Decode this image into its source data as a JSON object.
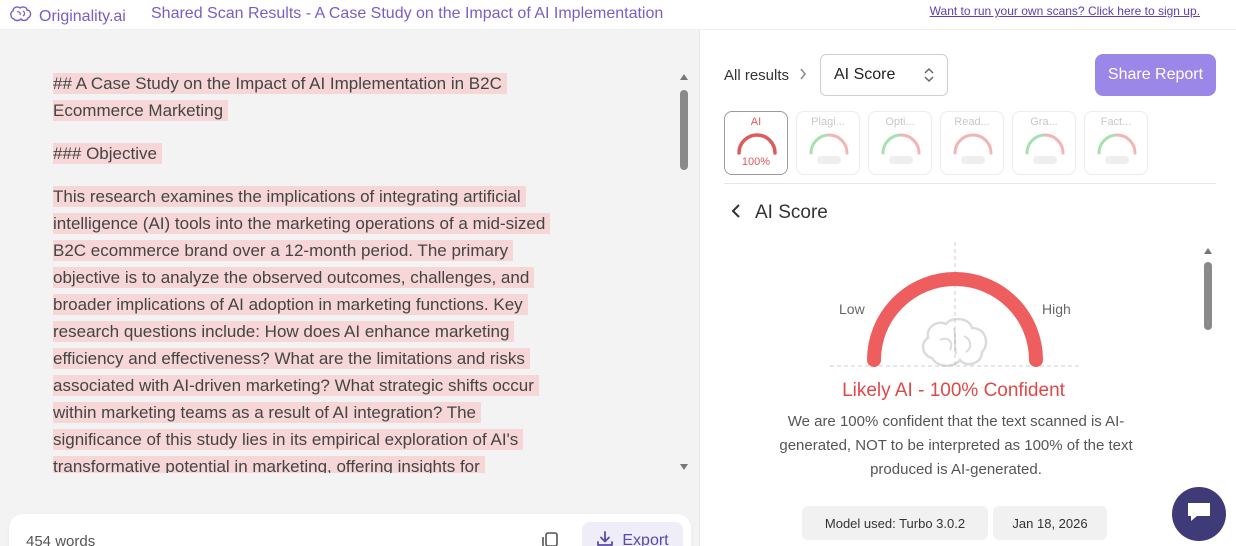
{
  "topbar": {
    "brand": "Originality.ai",
    "title": "Shared Scan Results - A Case Study on the Impact of AI Implementation",
    "signup_link": "Want to run your own scans? Click here to sign up."
  },
  "document": {
    "heading1_lines": [
      "## A Case Study on the Impact of AI Implementation in B2C",
      "Ecommerce Marketing"
    ],
    "heading2": "### Objective",
    "paragraph_lines": [
      "This research examines the implications of integrating artificial",
      "intelligence (AI) tools into the marketing operations of a mid-sized",
      "B2C ecommerce brand over a 12-month period. The primary",
      "objective is to analyze the observed outcomes, challenges, and",
      "broader implications of AI adoption in marketing functions. Key",
      "research questions include: How does AI enhance marketing",
      "efficiency and effectiveness? What are the limitations and risks",
      "associated with AI-driven marketing? What strategic shifts occur",
      "within marketing teams as a result of AI integration? The",
      "significance of this study lies in its empirical exploration of AI's",
      "transformative potential in marketing, offering insights for"
    ],
    "highlight_color": "#f6d6d6"
  },
  "footer": {
    "word_count": "454 words",
    "export_label": "Export"
  },
  "results": {
    "breadcrumb": "All results",
    "select_value": "AI Score",
    "share_label": "Share Report",
    "tabs": [
      {
        "label": "AI",
        "value": "100%",
        "active": true
      },
      {
        "label": "Plagi...",
        "value": "",
        "active": false
      },
      {
        "label": "Opti...",
        "value": "",
        "active": false
      },
      {
        "label": "Read...",
        "value": "",
        "active": false
      },
      {
        "label": "Gra...",
        "value": "",
        "active": false
      },
      {
        "label": "Fact...",
        "value": "",
        "active": false
      }
    ],
    "section_title": "AI Score",
    "gauge_low": "Low",
    "gauge_high": "High",
    "gauge_color": "#ee5e5e",
    "score": 1.0,
    "verdict": "Likely AI - 100% Confident",
    "explanation": "We are 100% confident that the text scanned is AI-generated, NOT to be interpreted as 100% of the text produced is AI-generated.",
    "model_chip": "Model used: Turbo 3.0.2",
    "date_chip": "Jan 18, 2026"
  },
  "colors": {
    "accent": "#7c5cc4",
    "share_button": "#9b87e8",
    "ai_red": "#e04848",
    "chat_bubble": "#3f3a78"
  }
}
